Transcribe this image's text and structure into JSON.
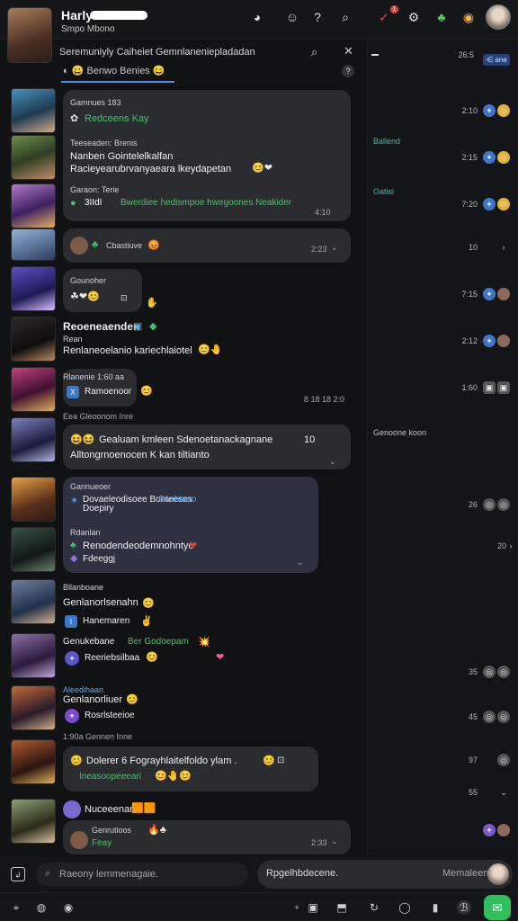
{
  "header": {
    "channel_name": "Harly",
    "channel_sub": "Smpo Mbono",
    "search_text": "Seremuniyly Caiheiet Gemnlaneniepladadan",
    "filter_chip": "Benwo  Benies",
    "notification_count": "1",
    "icons": [
      "discord-icon",
      "emoji-icon",
      "help-icon",
      "search-icon",
      "mention-icon",
      "gear-icon",
      "game-icon",
      "chrome-icon",
      "user-avatar"
    ]
  },
  "right_panel": {
    "pill": "⋲ ane",
    "rows": [
      {
        "time": "26:5"
      },
      {
        "time": "2:10"
      },
      {
        "label": "Ballend",
        "time": "2:15"
      },
      {
        "label": "Oatisi",
        "time": "7:20"
      },
      {
        "time": "10"
      },
      {
        "time": "7:15"
      },
      {
        "time": "2:12"
      },
      {
        "time": "1:60"
      },
      {
        "label": "Genoone koon"
      },
      {
        "time": "26"
      },
      {
        "time": "20"
      },
      {
        "time": "35"
      },
      {
        "time": "45"
      },
      {
        "time": "97"
      },
      {
        "time": "55"
      }
    ]
  },
  "messages": [
    {
      "name": "Gamnues 183",
      "line1": "Redceens Kay"
    },
    {
      "name": "Teeseaden: Brenis",
      "line1": "Nanben Gointelelkalfan",
      "line2": "Racieyearubrvanyaeara lkeydapetan",
      "meta": "Garaon: Terie",
      "green": "Bwerdiee hedismpoe hwegoones Neakider",
      "time": "4:10"
    },
    {
      "name": "Cbastiuve",
      "time": "2:23"
    },
    {
      "name": "Gounoher"
    },
    {
      "name": "Reoeneaenden",
      "sub": "Rean",
      "body": "Renlaneoelanio kariechlaiotel"
    },
    {
      "name": "Rlanenie 1:60 aa",
      "body": "Ramoenoor",
      "meta_right": "8 18 18 2:0"
    },
    {
      "pre": "Eea Gleoonom Inre",
      "body": "Gealuam kmleen Sdenoetanackagnane",
      "body2": "Alltongrnoenocen K kan tiltianto",
      "side": "10"
    },
    {
      "name": "Gannueoer",
      "line1": "Dovaeleodisoee Bonteeses",
      "blue": "Sanbiaoo",
      "line2": "Doepiry"
    },
    {
      "name": "Rdanlan",
      "line1": "Renodendeodemnohntyo",
      "line2": "Fdeeggj"
    },
    {
      "name": "Bllanboane",
      "line1": "Genlanorlsenahn",
      "line2": "Hanemaren"
    },
    {
      "name": "Genukebane",
      "green": "Ber Godoepam",
      "line2": "Reeriebsilbaa"
    },
    {
      "blue_name": "Aleedihaan",
      "line1": "Genlanorliuer",
      "line2": "Rosrlsteeioe"
    },
    {
      "pre": "1:90a Gennen Inne",
      "body": "Dolerer 6 Fograyhlaitelfoldo ylam .",
      "green": "Ineasoopeeeari"
    },
    {
      "name": "Nuceeenan",
      "line2": "Genrutioos",
      "green": "Feay",
      "time": "2:33"
    }
  ],
  "composer": {
    "placeholder": "Raeony lemmenagaie.",
    "placeholder2": "Rpgelhbdecene.",
    "right_label": "Memaleen"
  },
  "colors": {
    "accent": "#4c8be0",
    "green": "#43c56b",
    "bubble": "#2b2c30",
    "bg": "#111214"
  }
}
